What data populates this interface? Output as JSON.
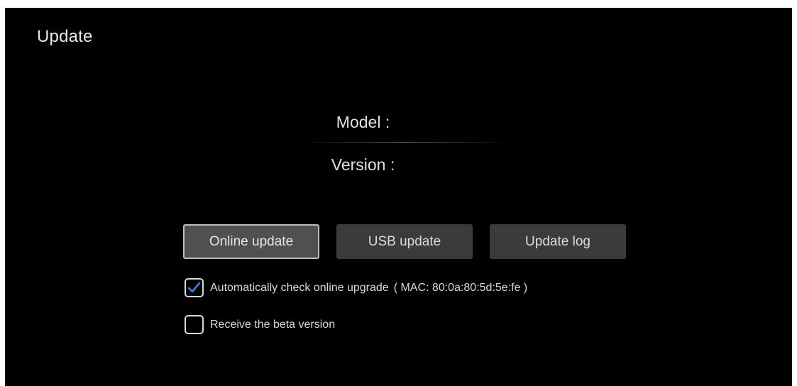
{
  "page": {
    "title": "Update"
  },
  "info": {
    "model_label": "Model :",
    "version_label": "Version :"
  },
  "buttons": {
    "online_update": "Online update",
    "usb_update": "USB update",
    "update_log": "Update log"
  },
  "options": {
    "auto_check": {
      "label": "Automatically check online upgrade",
      "mac": "( MAC: 80:0a:80:5d:5e:fe )",
      "checked": true,
      "icon": "checkmark-icon"
    },
    "beta": {
      "label": "Receive the beta version",
      "checked": false
    }
  },
  "colors": {
    "background": "#000000",
    "button": "#3b3b3b",
    "button_focused_border": "#bdbdbd",
    "checkmark": "#3d7fd6"
  }
}
